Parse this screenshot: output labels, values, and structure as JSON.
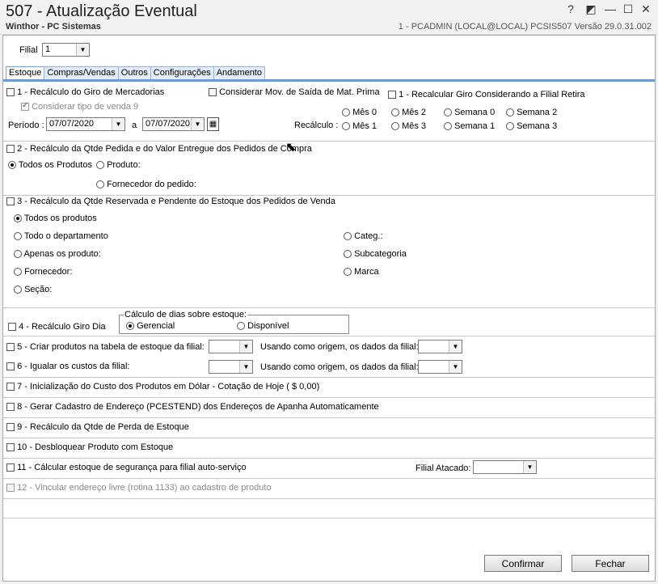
{
  "window": {
    "title": "507 - Atualização Eventual",
    "subtitle": "Winthor - PC Sistemas",
    "sysinfo": "1 - PCADMIN (LOCAL@LOCAL)   PCSIS507  Versão  29.0.31.002",
    "help_btn": "?",
    "tools_btn": "◩",
    "min_btn": "—",
    "max_btn": "☐",
    "close_btn": "✕"
  },
  "filial": {
    "label": "Filial",
    "value": "1"
  },
  "tabs": [
    {
      "label": "Estoque",
      "active": true
    },
    {
      "label": "Compras/Vendas"
    },
    {
      "label": "Outros"
    },
    {
      "label": "Configurações"
    },
    {
      "label": "Andamento"
    }
  ],
  "s1": {
    "label": "1 - Recálculo do Giro de Mercadorias",
    "mov_saida": "Considerar Mov. de Saída de Mat. Prima",
    "recalc_filial": "1 - Recalcular Giro Considerando a Filial Retira",
    "tipo_venda": "Considerar tipo de venda 9",
    "periodo_label": "Período :",
    "date_from": "07/07/2020",
    "a_label": "a",
    "date_to": "07/07/2020",
    "recalculo_label": "Recálculo :",
    "opts": [
      "Mês 0",
      "Mês 2",
      "Semana 0",
      "Semana 2",
      "Mês 1",
      "Mês 3",
      "Semana 1",
      "Semana 3"
    ]
  },
  "s2": {
    "label": "2 - Recálculo da Qtde Pedida e do Valor Entregue dos Pedidos de Compra",
    "todos": "Todos os Produtos",
    "produto": "Produto:",
    "fornecedor": "Fornecedor do pedido:"
  },
  "s3": {
    "label": "3 - Recálculo da Qtde Reservada e Pendente do Estoque dos Pedidos de Venda",
    "todos": "Todos os produtos",
    "departamento": "Todo o departamento",
    "apenas": "Apenas os produto:",
    "fornecedor": "Fornecedor:",
    "secao": "Seção:",
    "categ": "Categ.:",
    "subcategoria": "Subcategoria",
    "marca": "Marca"
  },
  "s4": {
    "label": "4 - Recálculo Giro Dia",
    "group": "Cálculo de dias sobre estoque:",
    "gerencial": "Gerencial",
    "disponivel": "Disponível"
  },
  "s5": {
    "label": "5 - Criar produtos na tabela de estoque da filial:",
    "origem": "Usando como origem, os dados da filial:"
  },
  "s6": {
    "label": "6 - Igualar os custos da filial:",
    "origem": "Usando como origem, os dados da filial:"
  },
  "s7": {
    "label": "7 - Inicialização do Custo dos Produtos em Dólar - Cotação de Hoje  ( $ 0,00)"
  },
  "s8": {
    "label": "8 - Gerar Cadastro de Endereço (PCESTEND) dos Endereços de Apanha Automaticamente"
  },
  "s9": {
    "label": "9 - Recálculo da Qtde de Perda de Estoque"
  },
  "s10": {
    "label": "10 - Desbloquear Produto com Estoque"
  },
  "s11": {
    "label": "11 - Cálcular estoque de segurança para filial auto-serviço",
    "filial_atacado": "Filial Atacado:"
  },
  "s12": {
    "label": "12 - Vincular endereço livre (rotina 1133) ao cadastro de produto"
  },
  "buttons": {
    "confirmar": "Confirmar",
    "fechar": "Fechar"
  }
}
